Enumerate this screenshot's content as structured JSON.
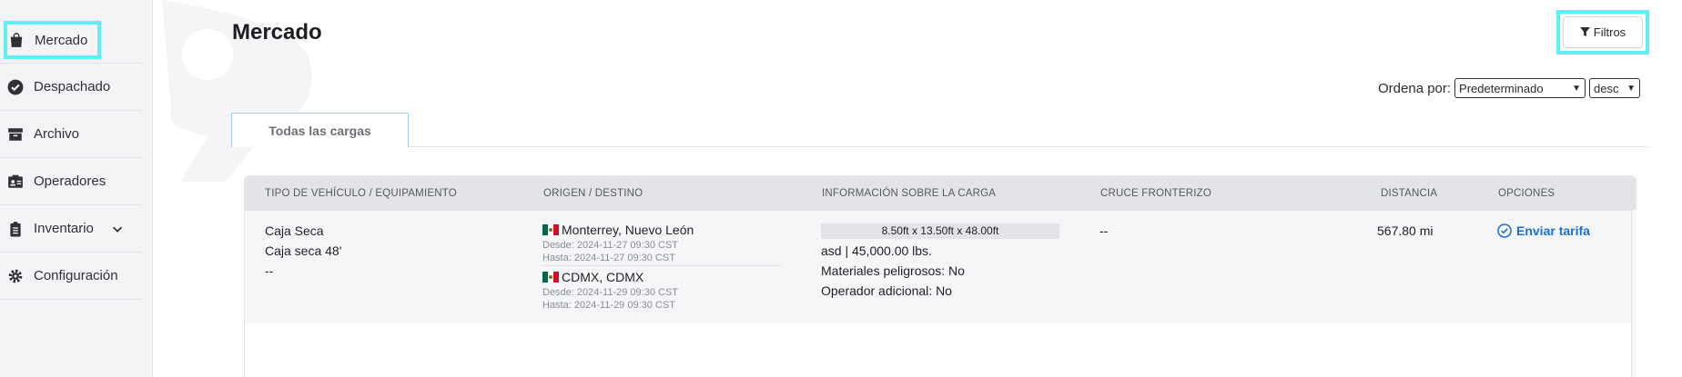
{
  "sidebar": {
    "items": [
      {
        "label": "Mercado",
        "icon": "shopping-bag-icon"
      },
      {
        "label": "Despachado",
        "icon": "check-circle-icon"
      },
      {
        "label": "Archivo",
        "icon": "archive-box-icon"
      },
      {
        "label": "Operadores",
        "icon": "id-card-icon"
      },
      {
        "label": "Inventario",
        "icon": "clipboard-icon"
      },
      {
        "label": "Configuración",
        "icon": "gear-icon"
      }
    ]
  },
  "header": {
    "title": "Mercado",
    "filter_label": "Filtros"
  },
  "sort": {
    "label": "Ordena por:",
    "selected": "Predeterminado",
    "direction": "desc"
  },
  "tabs": [
    {
      "label": "Todas las cargas",
      "active": true
    }
  ],
  "table": {
    "columns": [
      "TIPO DE VEHÍCULO / EQUIPAMIENTO",
      "ORIGEN / DESTINO",
      "INFORMACIÓN SOBRE LA CARGA",
      "CRUCE FRONTERIZO",
      "DISTANCIA",
      "OPCIONES"
    ],
    "rows": [
      {
        "vehicle_type": "Caja Seca",
        "equipment": "Caja seca 48'",
        "extra": "--",
        "origin": {
          "place": "Monterrey, Nuevo León",
          "from": "Desde: 2024-11-27 09:30 CST",
          "to": "Hasta: 2024-11-27 09:30 CST"
        },
        "destination": {
          "place": "CDMX, CDMX",
          "from": "Desde: 2024-11-29 09:30 CST",
          "to": "Hasta: 2024-11-29 09:30 CST"
        },
        "dimensions": "8.50ft x 13.50ft x 48.00ft",
        "weight": "asd | 45,000.00 lbs.",
        "hazmat": "Materiales peligrosos: No",
        "extra_operator": "Operador adicional: No",
        "border_crossing": "--",
        "distance": "567.80 mi",
        "action_label": "Enviar tarifa"
      }
    ]
  },
  "colors": {
    "highlight": "#5ff0f5",
    "link": "#1a6fd1",
    "header_bg": "#e3e4e7",
    "row_bg": "#f5f6f8"
  }
}
